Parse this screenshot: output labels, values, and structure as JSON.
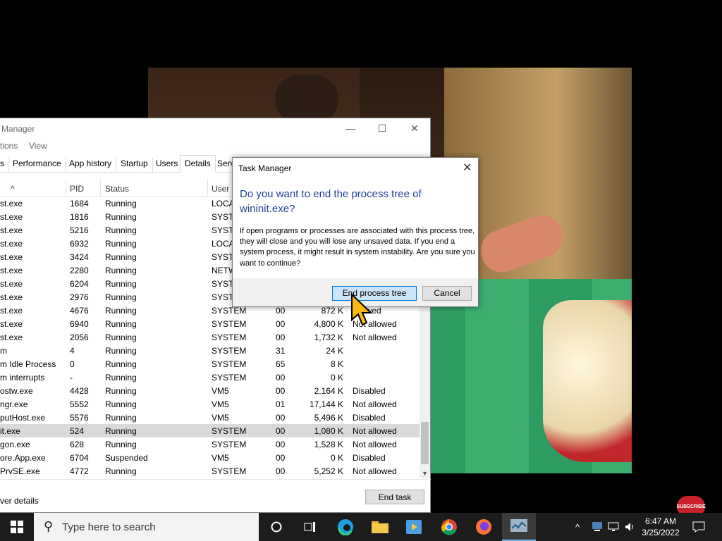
{
  "task_manager": {
    "title": "Manager",
    "menu": [
      "tions",
      "View"
    ],
    "tabs": [
      "s",
      "Performance",
      "App history",
      "Startup",
      "Users",
      "Details",
      "Serv"
    ],
    "active_tab": "Details",
    "columns": [
      "PID",
      "Status",
      "User n"
    ],
    "rows": [
      {
        "name": "st.exe",
        "pid": "1684",
        "status": "Running",
        "user": "LOCA",
        "cpu": "",
        "mem": "",
        "uac": ""
      },
      {
        "name": "st.exe",
        "pid": "1816",
        "status": "Running",
        "user": "SYSTE",
        "cpu": "",
        "mem": "",
        "uac": ""
      },
      {
        "name": "st.exe",
        "pid": "5216",
        "status": "Running",
        "user": "SYSTE",
        "cpu": "",
        "mem": "",
        "uac": ""
      },
      {
        "name": "st.exe",
        "pid": "6932",
        "status": "Running",
        "user": "LOCA",
        "cpu": "",
        "mem": "",
        "uac": ""
      },
      {
        "name": "st.exe",
        "pid": "3424",
        "status": "Running",
        "user": "SYSTE",
        "cpu": "",
        "mem": "",
        "uac": ""
      },
      {
        "name": "st.exe",
        "pid": "2280",
        "status": "Running",
        "user": "NETW",
        "cpu": "",
        "mem": "",
        "uac": ""
      },
      {
        "name": "st.exe",
        "pid": "6204",
        "status": "Running",
        "user": "SYSTE",
        "cpu": "",
        "mem": "",
        "uac": ""
      },
      {
        "name": "st.exe",
        "pid": "2976",
        "status": "Running",
        "user": "SYSTE",
        "cpu": "",
        "mem": "",
        "uac": ""
      },
      {
        "name": "st.exe",
        "pid": "4676",
        "status": "Running",
        "user": "SYSTEM",
        "cpu": "00",
        "mem": "872 K",
        "uac": "allowed"
      },
      {
        "name": "st.exe",
        "pid": "6940",
        "status": "Running",
        "user": "SYSTEM",
        "cpu": "00",
        "mem": "4,800 K",
        "uac": "Not allowed"
      },
      {
        "name": "st.exe",
        "pid": "2056",
        "status": "Running",
        "user": "SYSTEM",
        "cpu": "00",
        "mem": "1,732 K",
        "uac": "Not allowed"
      },
      {
        "name": "m",
        "pid": "4",
        "status": "Running",
        "user": "SYSTEM",
        "cpu": "31",
        "mem": "24 K",
        "uac": ""
      },
      {
        "name": "m Idle Process",
        "pid": "0",
        "status": "Running",
        "user": "SYSTEM",
        "cpu": "65",
        "mem": "8 K",
        "uac": ""
      },
      {
        "name": "m interrupts",
        "pid": "-",
        "status": "Running",
        "user": "SYSTEM",
        "cpu": "00",
        "mem": "0 K",
        "uac": ""
      },
      {
        "name": "ostw.exe",
        "pid": "4428",
        "status": "Running",
        "user": "VM5",
        "cpu": "00",
        "mem": "2,164 K",
        "uac": "Disabled"
      },
      {
        "name": "ngr.exe",
        "pid": "5552",
        "status": "Running",
        "user": "VM5",
        "cpu": "01",
        "mem": "17,144 K",
        "uac": "Not allowed"
      },
      {
        "name": "putHost.exe",
        "pid": "5576",
        "status": "Running",
        "user": "VM5",
        "cpu": "00",
        "mem": "5,496 K",
        "uac": "Disabled"
      },
      {
        "name": "it.exe",
        "pid": "524",
        "status": "Running",
        "user": "SYSTEM",
        "cpu": "00",
        "mem": "1,080 K",
        "uac": "Not allowed"
      },
      {
        "name": "gon.exe",
        "pid": "628",
        "status": "Running",
        "user": "SYSTEM",
        "cpu": "00",
        "mem": "1,528 K",
        "uac": "Not allowed"
      },
      {
        "name": "ore.App.exe",
        "pid": "6704",
        "status": "Suspended",
        "user": "VM5",
        "cpu": "00",
        "mem": "0 K",
        "uac": "Disabled"
      },
      {
        "name": "PrvSE.exe",
        "pid": "4772",
        "status": "Running",
        "user": "SYSTEM",
        "cpu": "00",
        "mem": "5,252 K",
        "uac": "Not allowed"
      }
    ],
    "selected_row": 17,
    "fewer_details": "ver details",
    "end_task": "End task"
  },
  "dialog": {
    "title": "Task Manager",
    "heading": "Do you want to end the process tree of wininit.exe?",
    "body": "If open programs or processes are associated with this process tree, they will close and you will lose any unsaved data. If you end a system process, it might result in system instability. Are you sure you want to continue?",
    "confirm": "End process tree",
    "cancel": "Cancel"
  },
  "taskbar": {
    "search_placeholder": "Type here to search",
    "time": "6:47 AM",
    "date": "3/25/2022"
  },
  "overlay": {
    "subscribe": "SUBSCRIBE"
  }
}
